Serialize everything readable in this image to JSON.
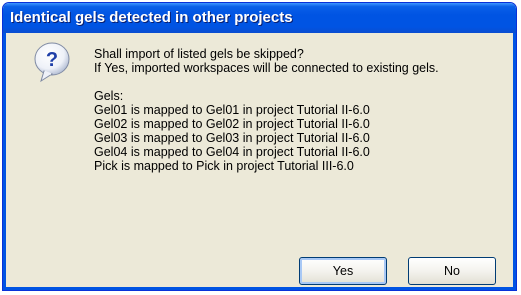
{
  "window": {
    "title": "Identical gels detected in other projects"
  },
  "icon": {
    "name": "question-icon",
    "glyph": "?"
  },
  "message": {
    "question": "Shall import of listed gels be skipped?",
    "detail": "If Yes, imported workspaces will be connected to existing gels.",
    "gels_heading": "Gels:",
    "gels": [
      "Gel01 is mapped to Gel01 in project Tutorial II-6.0",
      "Gel02 is mapped to Gel02 in project Tutorial II-6.0",
      "Gel03 is mapped to Gel03 in project Tutorial II-6.0",
      "Gel04 is mapped to Gel04 in project Tutorial II-6.0",
      "Pick is mapped to Pick in project Tutorial III-6.0"
    ]
  },
  "buttons": {
    "yes": "Yes",
    "no": "No"
  },
  "colors": {
    "titlebar": "#0054e3",
    "client": "#ece9d8",
    "icon_blue": "#1f3fa8"
  }
}
